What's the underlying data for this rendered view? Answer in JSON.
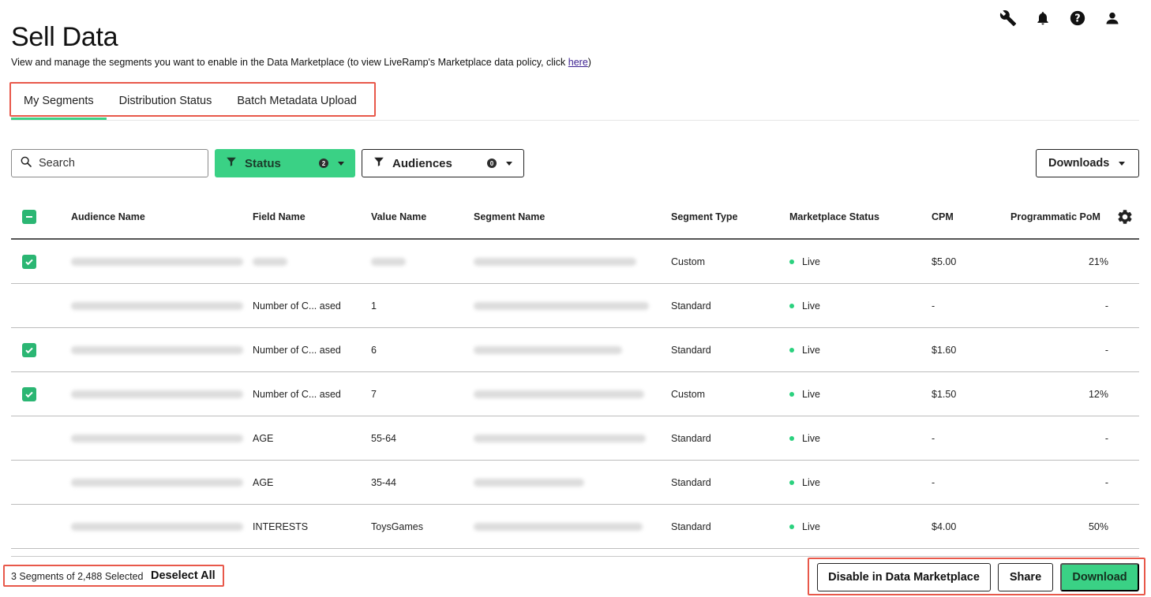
{
  "header": {
    "title": "Sell Data",
    "subtitle_text": "View and manage the segments you want to enable in the Data Marketplace (to view LiveRamp's Marketplace data policy, click ",
    "subtitle_link": "here",
    "subtitle_end": ")",
    "icons": [
      "wrench-icon",
      "bell-icon",
      "help-icon",
      "user-icon"
    ]
  },
  "tabs": [
    {
      "label": "My Segments",
      "active": true
    },
    {
      "label": "Distribution Status",
      "active": false
    },
    {
      "label": "Batch Metadata Upload",
      "active": false
    }
  ],
  "toolbar": {
    "search_placeholder": "Search",
    "status_filter": {
      "label": "Status",
      "count": "2"
    },
    "audiences_filter": {
      "label": "Audiences",
      "count": "0"
    },
    "downloads_label": "Downloads"
  },
  "table": {
    "columns": [
      "Audience Name",
      "Field Name",
      "Value Name",
      "Segment Name",
      "Segment Type",
      "Marketplace Status",
      "CPM",
      "Programmatic PoM"
    ],
    "rows": [
      {
        "checked": true,
        "audience": "",
        "field": "",
        "value": "",
        "segment": "",
        "type": "Custom",
        "status": "Live",
        "cpm": "$5.00",
        "pom": "21%"
      },
      {
        "checked": false,
        "audience": "",
        "field": "Number of C... ased",
        "value": "1",
        "segment": "",
        "type": "Standard",
        "status": "Live",
        "cpm": "-",
        "pom": "-"
      },
      {
        "checked": true,
        "audience": "",
        "field": "Number of C... ased",
        "value": "6",
        "segment": "",
        "type": "Standard",
        "status": "Live",
        "cpm": "$1.60",
        "pom": "-"
      },
      {
        "checked": true,
        "audience": "",
        "field": "Number of C... ased",
        "value": "7",
        "segment": "",
        "type": "Custom",
        "status": "Live",
        "cpm": "$1.50",
        "pom": "12%"
      },
      {
        "checked": false,
        "audience": "",
        "field": "AGE",
        "value": "55-64",
        "segment": "",
        "type": "Standard",
        "status": "Live",
        "cpm": "-",
        "pom": "-"
      },
      {
        "checked": false,
        "audience": "",
        "field": "AGE",
        "value": "35-44",
        "segment": "",
        "type": "Standard",
        "status": "Live",
        "cpm": "-",
        "pom": "-"
      },
      {
        "checked": false,
        "audience": "",
        "field": "INTERESTS",
        "value": "ToysGames",
        "segment": "",
        "type": "Standard",
        "status": "Live",
        "cpm": "$4.00",
        "pom": "50%"
      }
    ]
  },
  "footer": {
    "selection_text": "3 Segments of 2,488 Selected",
    "deselect_label": "Deselect All",
    "disable_label": "Disable in Data Marketplace",
    "share_label": "Share",
    "download_label": "Download"
  },
  "colors": {
    "accent": "#3ad185",
    "checkbox": "#2bb673",
    "live_dot": "#2bd17e",
    "highlight": "#e8584a"
  }
}
